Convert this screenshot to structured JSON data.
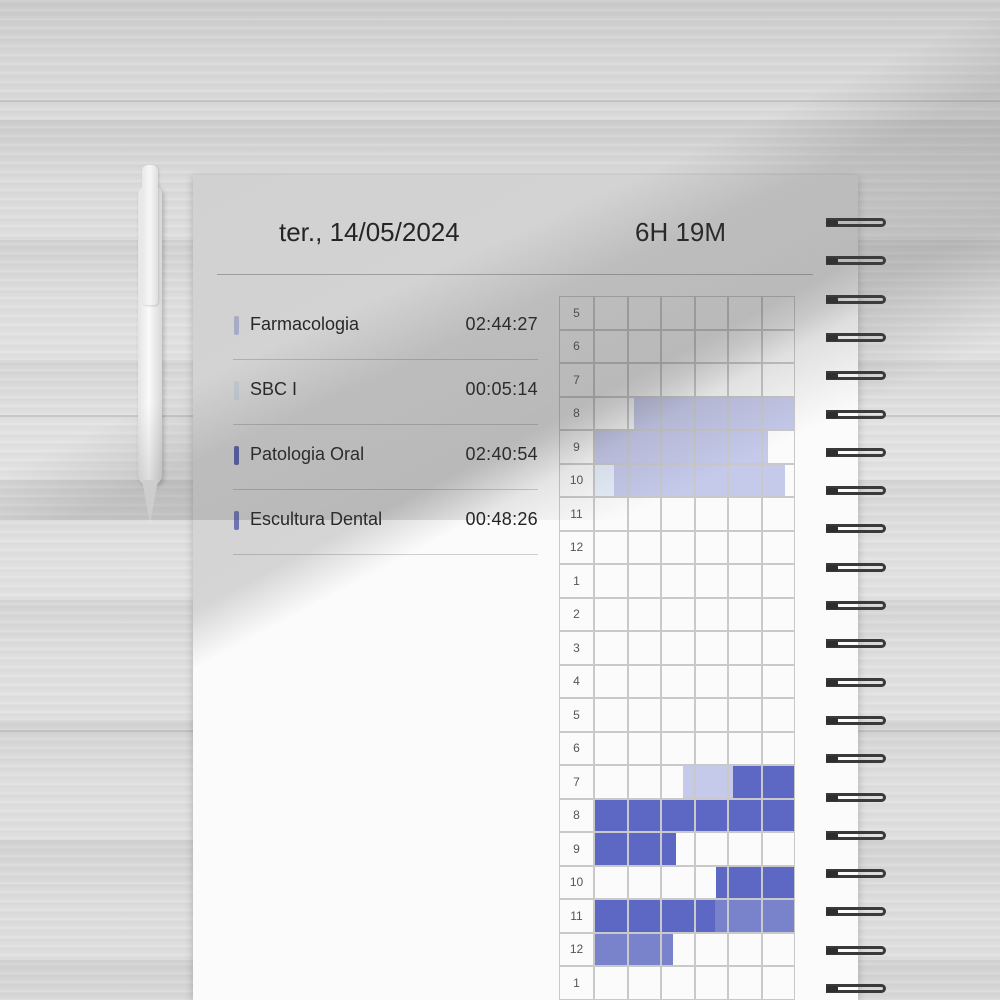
{
  "header": {
    "date": "ter., 14/05/2024",
    "total": "6H 19M"
  },
  "subjects": [
    {
      "name": "Farmacologia",
      "time": "02:44:27",
      "color": "#c5c9ea"
    },
    {
      "name": "SBC I",
      "time": "00:05:14",
      "color": "#e6effb"
    },
    {
      "name": "Patologia Oral",
      "time": "02:40:54",
      "color": "#5c68c4"
    },
    {
      "name": "Escultura Dental",
      "time": "00:48:26",
      "color": "#7883cc"
    }
  ],
  "timeline": {
    "hours": [
      "5",
      "6",
      "7",
      "8",
      "9",
      "10",
      "11",
      "12",
      "1",
      "2",
      "3",
      "4",
      "5",
      "6",
      "7",
      "8",
      "9",
      "10",
      "11",
      "12",
      "1"
    ],
    "columns": 6,
    "blocks": [
      {
        "row": 3,
        "start": 1.2,
        "end": 6,
        "subject": 0
      },
      {
        "row": 4,
        "start": 0,
        "end": 5.2,
        "subject": 0
      },
      {
        "row": 5,
        "start": 0,
        "end": 0.6,
        "subject": 1
      },
      {
        "row": 5,
        "start": 0.6,
        "end": 5.7,
        "subject": 0
      },
      {
        "row": 14,
        "start": 2.65,
        "end": 4.15,
        "subject": 0
      },
      {
        "row": 14,
        "start": 4.15,
        "end": 6,
        "subject": 2
      },
      {
        "row": 15,
        "start": 0,
        "end": 6,
        "subject": 2
      },
      {
        "row": 16,
        "start": 0,
        "end": 2.45,
        "subject": 2
      },
      {
        "row": 17,
        "start": 3.65,
        "end": 6,
        "subject": 2
      },
      {
        "row": 18,
        "start": 0,
        "end": 3.6,
        "subject": 2
      },
      {
        "row": 18,
        "start": 3.6,
        "end": 6,
        "subject": 3
      },
      {
        "row": 19,
        "start": 0,
        "end": 2.35,
        "subject": 3
      }
    ]
  }
}
